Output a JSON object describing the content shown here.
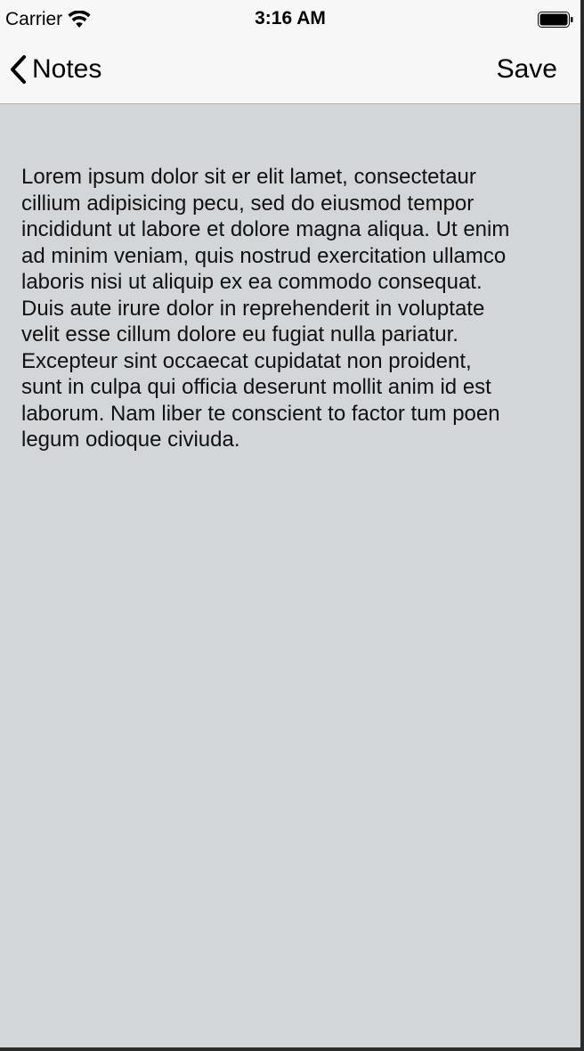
{
  "status_bar": {
    "carrier": "Carrier",
    "wifi_icon": "wifi-icon",
    "time": "3:16 AM",
    "battery_icon": "battery-icon"
  },
  "nav_bar": {
    "back_label": "Notes",
    "back_icon": "chevron-left-icon",
    "save_label": "Save"
  },
  "note": {
    "text": "Lorem ipsum dolor sit er elit lamet, consectetaur\ncillium adipisicing pecu, sed do eiusmod tempor\nincididunt ut labore et dolore magna aliqua. Ut enim\nad minim veniam, quis nostrud exercitation ullamco\nlaboris nisi ut aliquip ex ea commodo consequat.\nDuis aute irure dolor in reprehenderit in voluptate\nvelit esse cillum dolore eu fugiat nulla pariatur.\nExcepteur sint occaecat cupidatat non proident,\nsunt in culpa qui officia deserunt mollit anim id est\nlaborum. Nam liber te conscient to factor tum poen\nlegum odioque civiuda."
  },
  "colors": {
    "background": "#d2d6d9",
    "bars": "#f7f7f7",
    "frame": "#2a2a2a"
  }
}
